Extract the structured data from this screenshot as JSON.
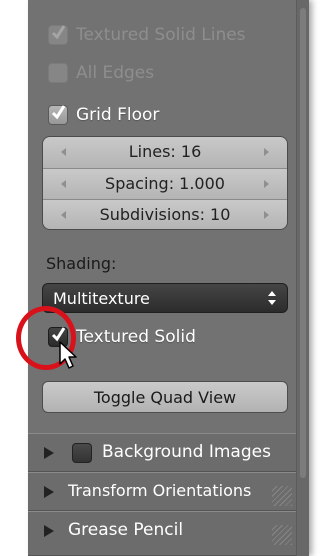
{
  "options": {
    "textured_solid_lines": {
      "label": "Textured Solid Lines"
    },
    "all_edges": {
      "label": "All Edges"
    },
    "grid_floor": {
      "label": "Grid Floor",
      "checked": true
    }
  },
  "grid": {
    "lines": "Lines: 16",
    "spacing": "Spacing: 1.000",
    "subdivisions": "Subdivisions: 10"
  },
  "shading": {
    "label": "Shading:",
    "value": "Multitexture",
    "textured_solid": {
      "label": "Textured Solid",
      "checked": true
    }
  },
  "toggle_quad_view": "Toggle Quad View",
  "sections": [
    {
      "label": "Background Images"
    },
    {
      "label": "Transform Orientations"
    },
    {
      "label": "Grease Pencil"
    }
  ],
  "colors": {
    "panel": "#727272",
    "highlight": "#d9111b"
  }
}
